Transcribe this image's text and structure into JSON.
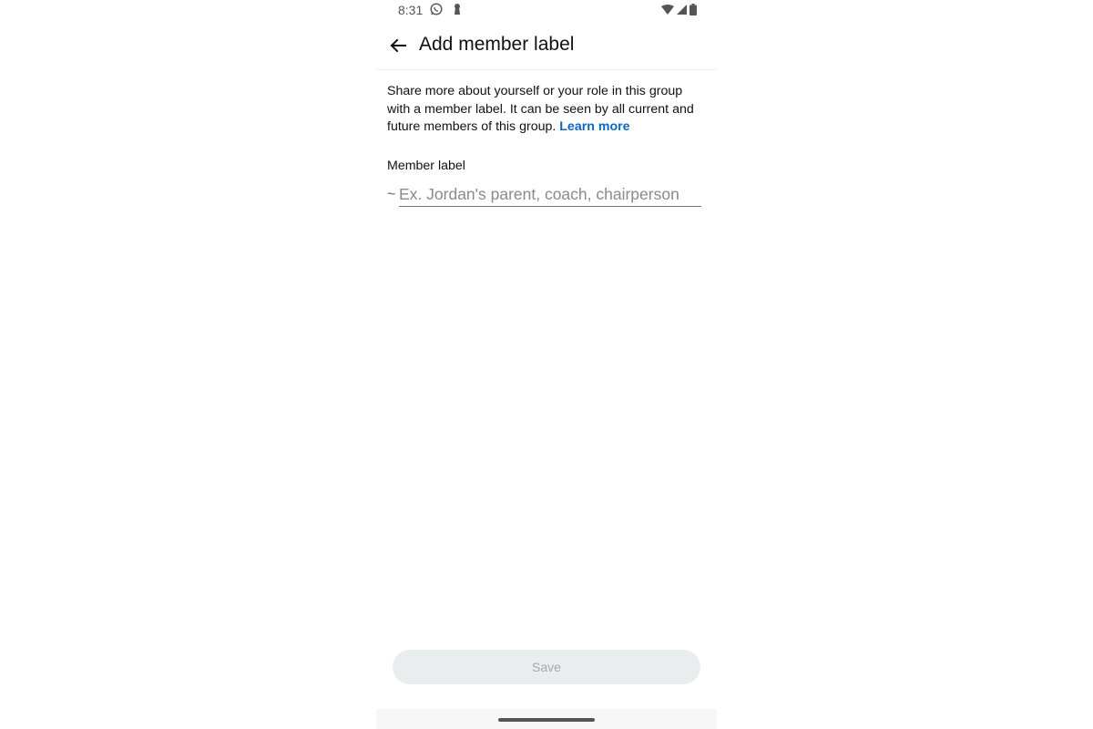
{
  "status_bar": {
    "time": "8:31",
    "left_icons": [
      "whatsapp-icon",
      "keyhole-icon"
    ],
    "right_icons": [
      "wifi-icon",
      "signal-icon",
      "battery-icon"
    ]
  },
  "app_bar": {
    "back_icon": "arrow-left-icon",
    "title": "Add member label"
  },
  "content": {
    "description": "Share more about yourself or your role in this group with a member label. It can be seen by all current and future members of this group.",
    "learn_more": "Learn more",
    "field_label": "Member label",
    "prefix": "~",
    "input_value": "",
    "input_placeholder": "Ex. Jordan's parent, coach, chairperson"
  },
  "footer": {
    "save_label": "Save"
  },
  "colors": {
    "link": "#0b66c2",
    "save_bg": "#e9edee",
    "save_text": "#a6aaac"
  }
}
